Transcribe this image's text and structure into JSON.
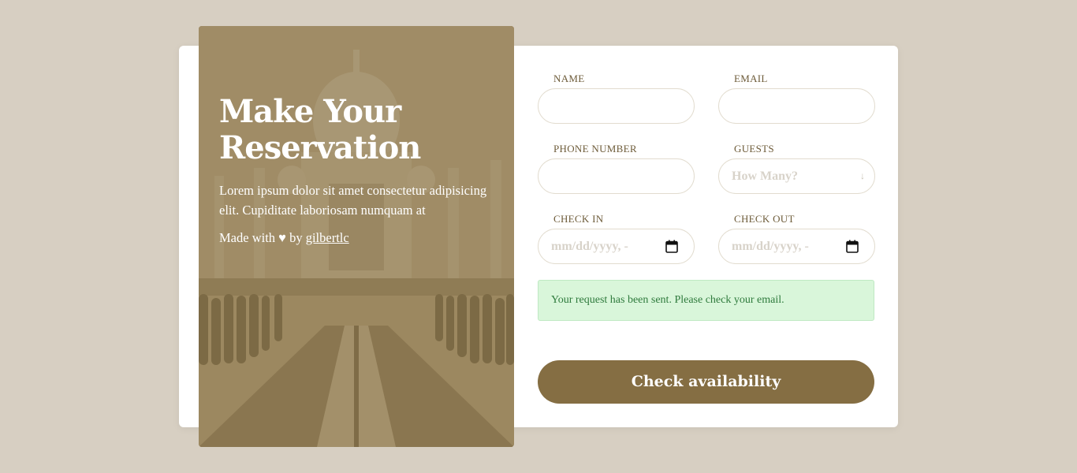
{
  "hero": {
    "title_line1": "Make Your",
    "title_line2": "Reservation",
    "description": "Lorem ipsum dolor sit amet consectetur adipisicing elit. Cupiditate laboriosam numquam at",
    "credit_prefix": "Made with ♥ by ",
    "credit_link": "gilbertlc"
  },
  "form": {
    "name_label": "NAME",
    "email_label": "EMAIL",
    "phone_label": "PHONE NUMBER",
    "guests_label": "GUESTS",
    "guests_placeholder": "How Many?",
    "checkin_label": "CHECK IN",
    "checkin_placeholder": "mm/dd/yyyy, -",
    "checkout_label": "CHECK OUT",
    "checkout_placeholder": "mm/dd/yyyy, -",
    "alert": "Your request has been sent. Please check your email.",
    "submit": "Check availability"
  },
  "colors": {
    "background": "#d7cfc2",
    "accent": "#856e43",
    "success_bg": "#d9f6da",
    "success_text": "#2e7a3c"
  },
  "icons": {
    "guests_select": "chevron-down-icon",
    "date_picker": "calendar-icon"
  }
}
